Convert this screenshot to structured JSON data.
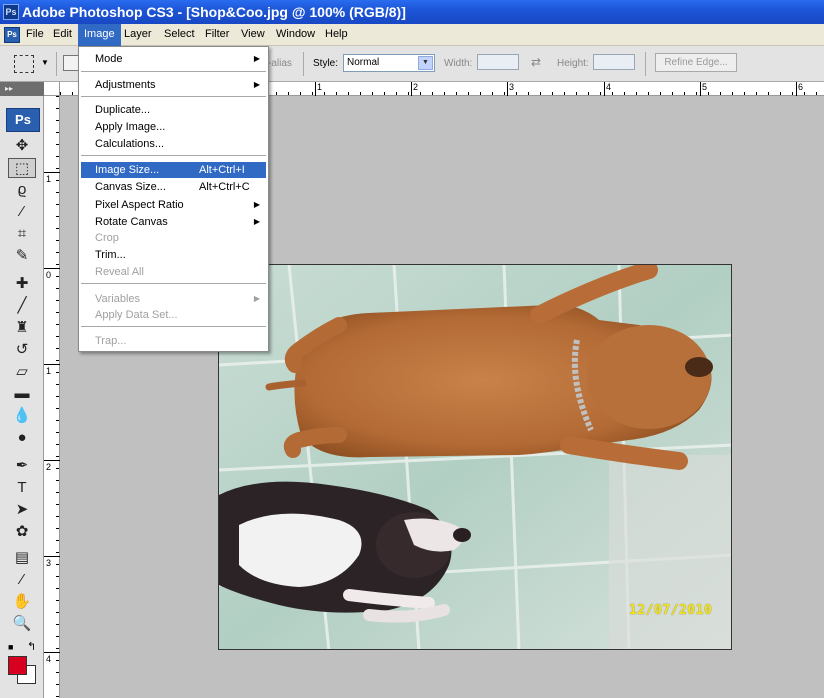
{
  "window": {
    "title": "Adobe Photoshop CS3 - [Shop&Coo.jpg @ 100% (RGB/8)]",
    "app_icon": "Ps"
  },
  "menubar": {
    "items": [
      "File",
      "Edit",
      "Image",
      "Layer",
      "Select",
      "Filter",
      "View",
      "Window",
      "Help"
    ],
    "active": "Image"
  },
  "options_bar": {
    "antialias_label": "-alias",
    "style_label": "Style:",
    "style_value": "Normal",
    "width_label": "Width:",
    "height_label": "Height:",
    "refine_edge_label": "Refine Edge..."
  },
  "toolbox": {
    "logo": "Ps",
    "foreground_color": "#d7001e",
    "background_color": "#ffffff"
  },
  "rulers": {
    "top_labels": [
      "1",
      "2",
      "3",
      "4",
      "5",
      "6"
    ],
    "left_labels": [
      "1",
      "0",
      "1",
      "2",
      "3",
      "4"
    ]
  },
  "image_menu": {
    "items": [
      {
        "label": "Mode",
        "submenu": true
      },
      {
        "label": "Adjustments",
        "submenu": true
      },
      {
        "label": "Duplicate..."
      },
      {
        "label": "Apply Image..."
      },
      {
        "label": "Calculations..."
      },
      {
        "label": "Image Size...",
        "shortcut": "Alt+Ctrl+I",
        "highlighted": true
      },
      {
        "label": "Canvas Size...",
        "shortcut": "Alt+Ctrl+C"
      },
      {
        "label": "Pixel Aspect Ratio",
        "submenu": true
      },
      {
        "label": "Rotate Canvas",
        "submenu": true
      },
      {
        "label": "Crop",
        "disabled": true
      },
      {
        "label": "Trim..."
      },
      {
        "label": "Reveal All",
        "disabled": true
      },
      {
        "label": "Variables",
        "submenu": true,
        "disabled": true
      },
      {
        "label": "Apply Data Set...",
        "disabled": true
      },
      {
        "label": "Trap...",
        "disabled": true
      }
    ]
  },
  "photo": {
    "date_stamp": "12/07/2010"
  },
  "colors": {
    "titlebar": "#1d56d8",
    "menu_highlight": "#316ac5",
    "workspace": "#c0c0c0"
  }
}
